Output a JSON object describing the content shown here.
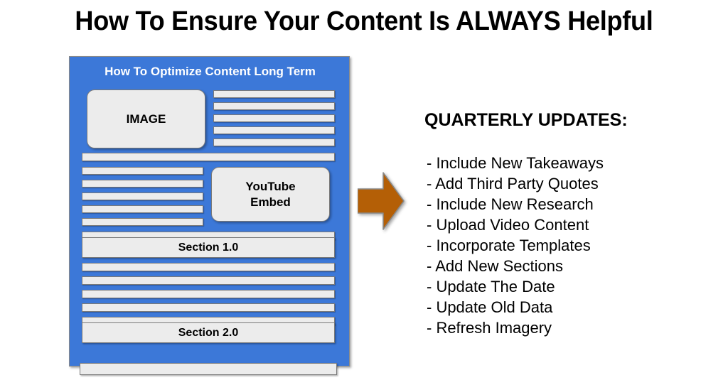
{
  "title": "How To Ensure Your Content Is ALWAYS Helpful",
  "document_mock": {
    "heading": "How To Optimize Content Long Term",
    "image_block_label": "IMAGE",
    "video_block_label": "YouTube\nEmbed",
    "video_block_line1": "YouTube",
    "video_block_line2": "Embed",
    "section_1_label": "Section 1.0",
    "section_2_label": "Section 2.0",
    "panel_color": "#3C78D8",
    "bar_color": "#ECECEC",
    "bar_border_color": "#7A7A7A",
    "text_line_counts": {
      "top_right_column": 5,
      "after_image_full_width": 1,
      "left_column_beside_video": 5,
      "after_video_full_width": 1,
      "between_sections": 5,
      "below_section_two": 1
    }
  },
  "arrow": {
    "direction": "right",
    "color": "#B45F06",
    "outline_color": "#8A8A8A"
  },
  "updates": {
    "heading": "QUARTERLY UPDATES:",
    "items": [
      "- Include New Takeaways",
      "- Add Third Party Quotes",
      "- Include New Research",
      "- Upload Video Content",
      "- Incorporate Templates",
      "- Add New Sections",
      "- Update The Date",
      "- Update Old Data",
      "- Refresh Imagery"
    ]
  }
}
